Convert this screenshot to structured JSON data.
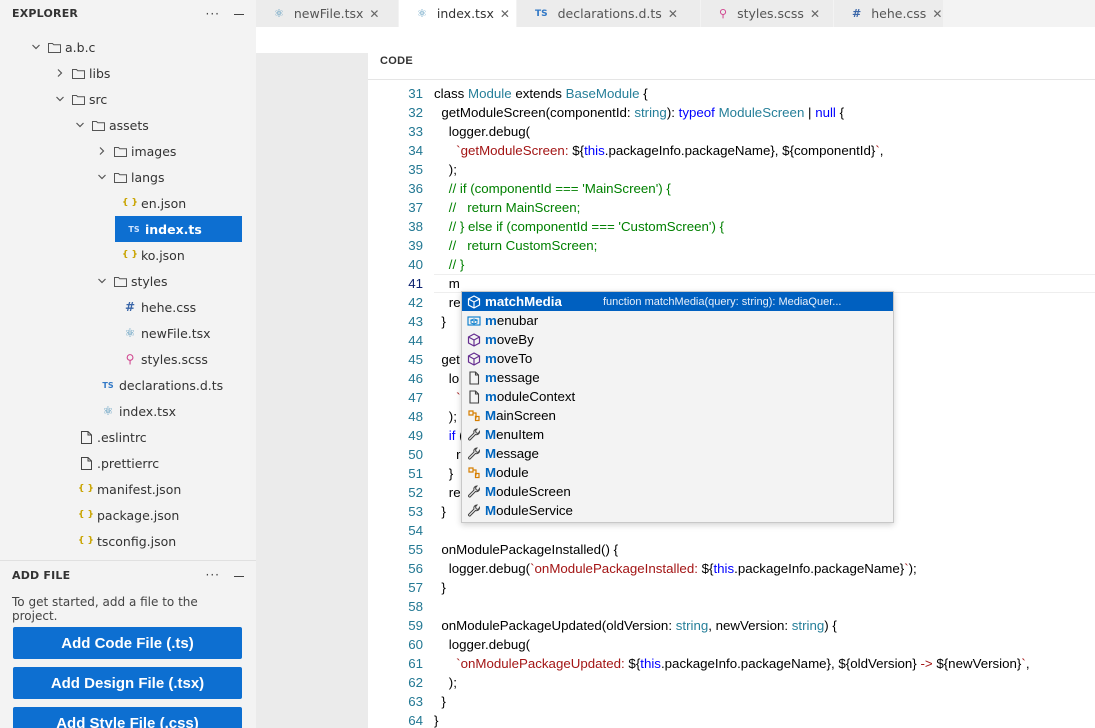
{
  "explorer": {
    "title": "EXPLORER",
    "more": "···",
    "tree": [
      {
        "label": "a.b.c",
        "kind": "folder",
        "depth": 0,
        "open": true
      },
      {
        "label": "libs",
        "kind": "folder",
        "depth": 1,
        "open": false
      },
      {
        "label": "src",
        "kind": "folder",
        "depth": 1,
        "open": true
      },
      {
        "label": "assets",
        "kind": "folder",
        "depth": 2,
        "open": true
      },
      {
        "label": "images",
        "kind": "folder",
        "depth": 3,
        "open": false
      },
      {
        "label": "langs",
        "kind": "folder",
        "depth": 3,
        "open": true
      },
      {
        "label": "en.json",
        "kind": "json",
        "depth": 4
      },
      {
        "label": "index.ts",
        "kind": "ts",
        "depth": 4,
        "selected": true
      },
      {
        "label": "ko.json",
        "kind": "json",
        "depth": 4
      },
      {
        "label": "styles",
        "kind": "folder",
        "depth": 3,
        "open": true
      },
      {
        "label": "hehe.css",
        "kind": "css",
        "depth": 4
      },
      {
        "label": "newFile.tsx",
        "kind": "tsx",
        "depth": 4
      },
      {
        "label": "styles.scss",
        "kind": "scss",
        "depth": 4
      },
      {
        "label": "declarations.d.ts",
        "kind": "ts",
        "depth": 3
      },
      {
        "label": "index.tsx",
        "kind": "tsx",
        "depth": 3
      },
      {
        "label": ".eslintrc",
        "kind": "file",
        "depth": 2
      },
      {
        "label": ".prettierrc",
        "kind": "file",
        "depth": 2
      },
      {
        "label": "manifest.json",
        "kind": "json",
        "depth": 2
      },
      {
        "label": "package.json",
        "kind": "json",
        "depth": 2
      },
      {
        "label": "tsconfig.json",
        "kind": "json",
        "depth": 2
      }
    ]
  },
  "add_file": {
    "title": "ADD FILE",
    "more": "···",
    "hint": "To get started, add a file to the project.",
    "buttons": [
      "Add Code File (.ts)",
      "Add Design File (.tsx)",
      "Add Style File (.css)"
    ]
  },
  "tabs": [
    {
      "label": "newFile.tsx",
      "icon": "react-icon",
      "icon_text": "⚛",
      "active": false
    },
    {
      "label": "index.tsx",
      "icon": "react-icon",
      "icon_text": "⚛",
      "active": true
    },
    {
      "label": "declarations.d.ts",
      "icon": "ts-icon",
      "icon_text": "TS",
      "active": false
    },
    {
      "label": "styles.scss",
      "icon": "scss-icon",
      "icon_text": "⚲",
      "active": false
    },
    {
      "label": "hehe.css",
      "icon": "css-icon",
      "icon_text": "#",
      "active": false
    }
  ],
  "tab_close_glyph": "✕",
  "editor": {
    "section_title": "CODE",
    "current_line": 41,
    "lines": [
      {
        "n": "31",
        "html": "class <span class=\"cls\">Module</span> extends <span class=\"cls\">BaseModule</span> {"
      },
      {
        "n": "32",
        "html": "  getModuleScreen(componentId: <span class=\"type\">string</span>): <span class=\"kw\">typeof</span> <span class=\"cls\">ModuleScreen</span> | <span class=\"kw\">null</span> {"
      },
      {
        "n": "33",
        "html": "    logger.debug("
      },
      {
        "n": "34",
        "html": "      <span class=\"str\">`getModuleScreen: </span>${<span class=\"kw\">this</span>.packageInfo.packageName}, ${componentId}<span class=\"str\">`</span>,"
      },
      {
        "n": "35",
        "html": "    );"
      },
      {
        "n": "36",
        "html": "    <span class=\"cmt\">// if (componentId === 'MainScreen') {</span>"
      },
      {
        "n": "37",
        "html": "    <span class=\"cmt\">//   return MainScreen;</span>"
      },
      {
        "n": "38",
        "html": "    <span class=\"cmt\">// } else if (componentId === 'CustomScreen') {</span>"
      },
      {
        "n": "39",
        "html": "    <span class=\"cmt\">//   return CustomScreen;</span>"
      },
      {
        "n": "40",
        "html": "    <span class=\"cmt\">// }</span>"
      },
      {
        "n": "41",
        "html": "    m"
      },
      {
        "n": "42",
        "html": "    re"
      },
      {
        "n": "43",
        "html": "  }"
      },
      {
        "n": "44",
        "html": ""
      },
      {
        "n": "45",
        "html": "  get                                                                              {"
      },
      {
        "n": "46",
        "html": "    lo"
      },
      {
        "n": "47",
        "html": "      <span class=\"str\">`</span>                                                                         ntId}<span class=\"str\">`</span>,"
      },
      {
        "n": "48",
        "html": "    );"
      },
      {
        "n": "49",
        "html": "    <span class=\"kw\">if</span> ("
      },
      {
        "n": "50",
        "html": "      r"
      },
      {
        "n": "51",
        "html": "    }"
      },
      {
        "n": "52",
        "html": "    re"
      },
      {
        "n": "53",
        "html": "  }"
      },
      {
        "n": "54",
        "html": ""
      },
      {
        "n": "55",
        "html": "  onModulePackageInstalled() {"
      },
      {
        "n": "56",
        "html": "    logger.debug(<span class=\"str\">`onModulePackageInstalled: </span>${<span class=\"kw\">this</span>.packageInfo.packageName}<span class=\"str\">`</span>);"
      },
      {
        "n": "57",
        "html": "  }"
      },
      {
        "n": "58",
        "html": ""
      },
      {
        "n": "59",
        "html": "  onModulePackageUpdated(oldVersion: <span class=\"type\">string</span>, newVersion: <span class=\"type\">string</span>) {"
      },
      {
        "n": "60",
        "html": "    logger.debug("
      },
      {
        "n": "61",
        "html": "      <span class=\"str\">`onModulePackageUpdated: </span>${<span class=\"kw\">this</span>.packageInfo.packageName}, ${oldVersion} <span class=\"str\">-&gt;</span> ${newVersion}<span class=\"str\">`</span>,"
      },
      {
        "n": "62",
        "html": "    );"
      },
      {
        "n": "63",
        "html": "  }"
      },
      {
        "n": "64",
        "html": "}"
      }
    ]
  },
  "suggestions": {
    "typed": "m",
    "items": [
      {
        "label": "matchMedia",
        "match": "m",
        "rest": "atchMedia",
        "icon": "method-icon",
        "detail": "function matchMedia(query: string): MediaQuer...",
        "focused": true
      },
      {
        "label": "menubar",
        "match": "m",
        "rest": "enubar",
        "icon": "variable-icon"
      },
      {
        "label": "moveBy",
        "match": "m",
        "rest": "oveBy",
        "icon": "method-icon"
      },
      {
        "label": "moveTo",
        "match": "m",
        "rest": "oveTo",
        "icon": "method-icon"
      },
      {
        "label": "message",
        "match": "m",
        "rest": "essage",
        "icon": "text-icon"
      },
      {
        "label": "moduleContext",
        "match": "m",
        "rest": "oduleContext",
        "icon": "text-icon"
      },
      {
        "label": "MainScreen",
        "match": "M",
        "rest": "ainScreen",
        "icon": "class-icon"
      },
      {
        "label": "MenuItem",
        "match": "M",
        "rest": "enuItem",
        "icon": "wrench-icon"
      },
      {
        "label": "Message",
        "match": "M",
        "rest": "essage",
        "icon": "wrench-icon"
      },
      {
        "label": "Module",
        "match": "M",
        "rest": "odule",
        "icon": "class-icon"
      },
      {
        "label": "ModuleScreen",
        "match": "M",
        "rest": "oduleScreen",
        "icon": "wrench-icon"
      },
      {
        "label": "ModuleService",
        "match": "M",
        "rest": "oduleService",
        "icon": "wrench-icon"
      }
    ]
  },
  "colors": {
    "accent": "#0d6fd1",
    "suggest_focus": "#0060c0"
  }
}
